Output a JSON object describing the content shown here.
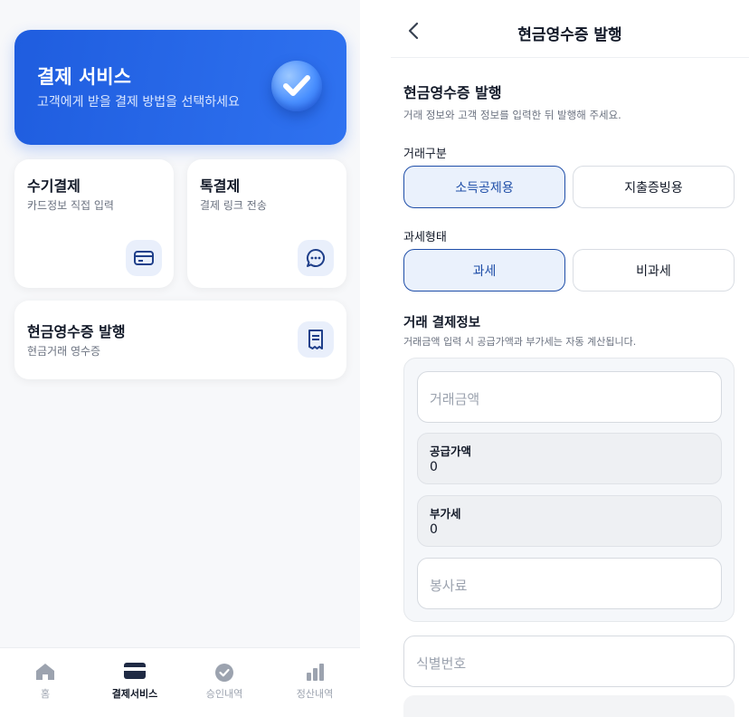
{
  "left": {
    "hero": {
      "title": "결제 서비스",
      "subtitle": "고객에게 받을 결제 방법을 선택하세요",
      "icon": "check-badge-icon"
    },
    "cards": [
      {
        "title": "수기결제",
        "subtitle": "카드정보 직접 입력",
        "icon": "credit-card-icon"
      },
      {
        "title": "톡결제",
        "subtitle": "결제 링크 전송",
        "icon": "chat-bubble-icon"
      },
      {
        "title": "현금영수증 발행",
        "subtitle": "현금거래 영수증",
        "icon": "receipt-icon"
      }
    ],
    "tabbar": [
      {
        "label": "홈",
        "icon": "home-icon",
        "active": false
      },
      {
        "label": "결제서비스",
        "icon": "card-icon",
        "active": true
      },
      {
        "label": "승인내역",
        "icon": "check-circle-icon",
        "active": false
      },
      {
        "label": "정산내역",
        "icon": "bar-chart-icon",
        "active": false
      }
    ]
  },
  "right": {
    "header": {
      "title": "현금영수증 발행",
      "back_icon": "chevron-left-icon"
    },
    "intro": {
      "title": "현금영수증 발행",
      "description": "거래 정보와 고객 정보를 입력한 뒤 발행해 주세요."
    },
    "transaction_type": {
      "label": "거래구분",
      "options": [
        "소득공제용",
        "지출증빙용"
      ],
      "selected": "소득공제용"
    },
    "tax_type": {
      "label": "과세형태",
      "options": [
        "과세",
        "비과세"
      ],
      "selected": "과세"
    },
    "payment_info": {
      "title": "거래 결제정보",
      "description": "거래금액 입력 시 공급가액과 부가세는 자동 계산됩니다.",
      "amount_placeholder": "거래금액",
      "supply_label": "공급가액",
      "supply_value": "0",
      "vat_label": "부가세",
      "vat_value": "0",
      "service_placeholder": "봉사료"
    },
    "id_placeholder": "식별번호"
  },
  "colors": {
    "brand": "#2563eb",
    "selected_border": "#1f4ea8",
    "selected_bg": "#eaf1fc"
  }
}
